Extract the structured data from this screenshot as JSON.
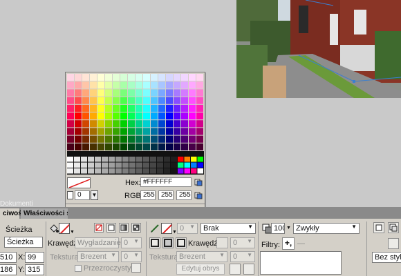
{
  "colors": {
    "accent_red": "#e02020",
    "panel_bg": "#d4d0c8",
    "workspace_bg": "#c9c9c9"
  },
  "picker": {
    "hex_label": "Hex:",
    "hex_value": "#FFFFFF",
    "rgb_label": "RGB:",
    "rgb": [
      "255",
      "255",
      "255"
    ],
    "alpha_value": "0"
  },
  "workspace": {
    "document_label": "Dokumenti"
  },
  "panel": {
    "tabs": [
      "ciwości",
      "Właściwości symbolu"
    ],
    "object": {
      "type_label": "Ścieżka",
      "name_value": "Ścieżka"
    },
    "position": {
      "x_value_left": "510",
      "x_label": "X:",
      "x_value": "99",
      "y_value_left": "186",
      "y_label": "Y:",
      "y_value": "315"
    },
    "fill": {
      "edge_label": "Krawędź:",
      "edge_value": "Wygładzanie",
      "edge_amount": "0",
      "texture_label": "Tekstura:",
      "texture_value": "Brezent",
      "texture_amount": "0",
      "transparent_label": "Przezroczysty"
    },
    "stroke": {
      "width_value": "0",
      "style_value": "Brak",
      "edge_label": "Krawędź:",
      "edge_amount": "0",
      "texture_label": "Tekstura:",
      "texture_value": "Brezent",
      "texture_amount": "0",
      "edit_button": "Edytuj obrys"
    },
    "opacity": {
      "value": "100",
      "blend_value": "Zwykły"
    },
    "filters": {
      "label": "Filtry:",
      "add": "+,"
    },
    "style": {
      "value": "Bez stylu"
    }
  }
}
